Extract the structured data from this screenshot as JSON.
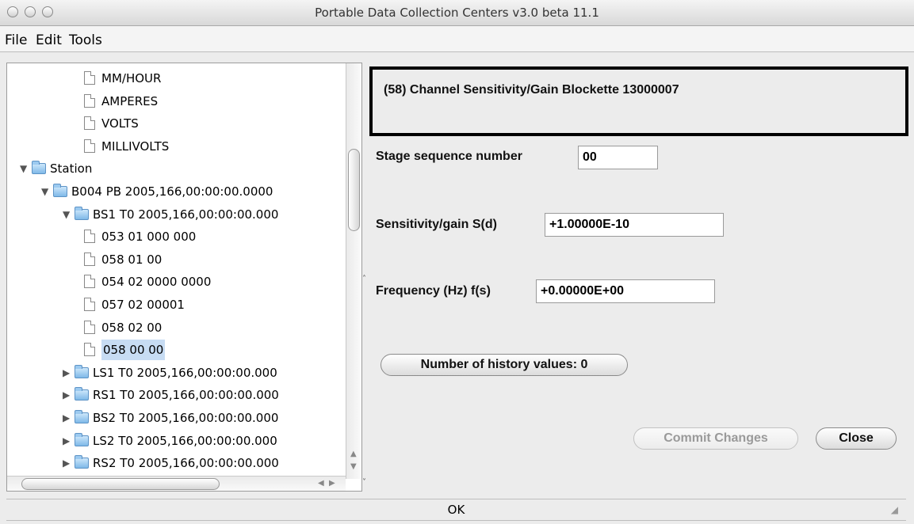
{
  "window": {
    "title": "Portable Data Collection Centers v3.0 beta 11.1"
  },
  "menu": [
    "File",
    "Edit",
    "Tools"
  ],
  "tree": {
    "rows": [
      {
        "label": "MM/HOUR",
        "type": "doc"
      },
      {
        "label": "AMPERES",
        "type": "doc"
      },
      {
        "label": "VOLTS",
        "type": "doc"
      },
      {
        "label": "MILLIVOLTS",
        "type": "doc"
      },
      {
        "label": "Station",
        "type": "folder",
        "expanded": true
      },
      {
        "label": "B004 PB 2005,166,00:00:00.0000",
        "type": "folder",
        "expanded": true
      },
      {
        "label": "BS1 T0 2005,166,00:00:00.000",
        "type": "folder",
        "expanded": true
      },
      {
        "label": "053 01 000 000",
        "type": "doc"
      },
      {
        "label": "058 01 00",
        "type": "doc"
      },
      {
        "label": "054 02 0000 0000",
        "type": "doc"
      },
      {
        "label": "057 02 00001",
        "type": "doc"
      },
      {
        "label": "058 02 00",
        "type": "doc"
      },
      {
        "label": "058 00 00",
        "type": "doc",
        "selected": true
      },
      {
        "label": "LS1 T0 2005,166,00:00:00.000",
        "type": "folder",
        "expanded": false
      },
      {
        "label": "RS1 T0 2005,166,00:00:00.000",
        "type": "folder",
        "expanded": false
      },
      {
        "label": "BS2 T0 2005,166,00:00:00.000",
        "type": "folder",
        "expanded": false
      },
      {
        "label": "LS2 T0 2005,166,00:00:00.000",
        "type": "folder",
        "expanded": false
      },
      {
        "label": "RS2 T0 2005,166,00:00:00.000",
        "type": "folder",
        "expanded": false
      }
    ]
  },
  "detail": {
    "header": "(58) Channel Sensitivity/Gain Blockette 13000007",
    "stage_label": "Stage sequence number",
    "stage_value": "00",
    "sensitivity_label": "Sensitivity/gain S(d)",
    "sensitivity_value": "+1.00000E-10",
    "frequency_label": "Frequency (Hz) f(s)",
    "frequency_value": "+0.00000E+00",
    "history_button": "Number of history values: 0",
    "commit_button": "Commit Changes",
    "close_button": "Close"
  },
  "status": {
    "text": "OK"
  }
}
